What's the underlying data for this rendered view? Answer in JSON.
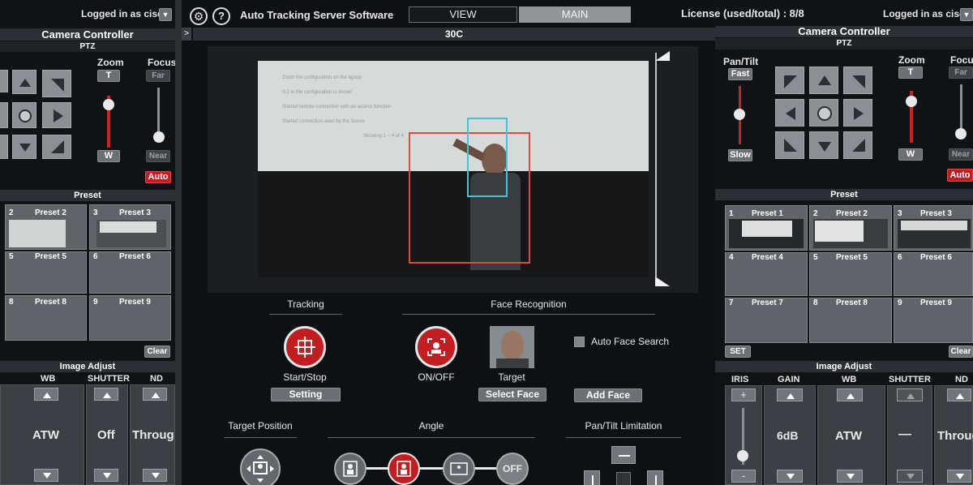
{
  "header": {
    "left_login": "Logged in as cisco",
    "title": "Auto Tracking Server Software",
    "tabs": [
      {
        "label": "VIEW"
      },
      {
        "label": "MAIN"
      }
    ],
    "license": "License (used/total) : 8/8",
    "right_login": "Logged in as cisco"
  },
  "left": {
    "title": "Camera Controller",
    "ptz": "PTZ",
    "zoom": "Zoom",
    "zoom_t": "T",
    "zoom_w": "W",
    "focus": "Focus",
    "focus_far": "Far",
    "focus_near": "Near",
    "focus_auto": "Auto",
    "preset_title": "Preset",
    "presets": [
      "2",
      "Preset 2",
      "3",
      "Preset 3",
      "5",
      "Preset 5",
      "6",
      "Preset 6",
      "8",
      "Preset 8",
      "9",
      "Preset 9"
    ],
    "clear": "Clear",
    "image_adjust": "Image Adjust",
    "wb": "WB",
    "shutter": "SHUTTER",
    "nd": "ND",
    "wb_val": "ATW",
    "shutter_val": "Off",
    "nd_val": "Throug"
  },
  "center": {
    "camera_name": "30C",
    "projected_text": [
      "Zoom the configuration on the laptop",
      "S.2 in the configuration is shown",
      "Started remote connection with an access function",
      "Started connection seen by the Server",
      "Showing 1 ~ 4 of 4"
    ],
    "tracking": "Tracking",
    "start_stop": "Start/Stop",
    "setting": "Setting",
    "face_recognition": "Face Recognition",
    "on_off": "ON/OFF",
    "target": "Target",
    "select_face": "Select Face",
    "auto_face_search": "Auto Face Search",
    "add_face": "Add Face",
    "target_position": "Target Position",
    "angle": "Angle",
    "angle_off": "OFF",
    "pan_tilt_limitation": "Pan/Tilt Limitation"
  },
  "right": {
    "title": "Camera Controller",
    "ptz": "PTZ",
    "pan_tilt": "Pan/Tilt",
    "fast": "Fast",
    "slow": "Slow",
    "zoom": "Zoom",
    "zoom_t": "T",
    "zoom_w": "W",
    "focus": "Focus",
    "focus_far": "Far",
    "focus_near": "Near",
    "focus_auto": "Auto",
    "preset_title": "Preset",
    "presets": [
      "1",
      "Preset 1",
      "2",
      "Preset 2",
      "3",
      "Preset 3",
      "4",
      "Preset 4",
      "5",
      "Preset 5",
      "6",
      "Preset 6",
      "7",
      "Preset 7",
      "8",
      "Preset 8",
      "9",
      "Preset 9"
    ],
    "set": "SET",
    "clear": "Clear",
    "image_adjust": "Image Adjust",
    "iris": "IRIS",
    "gain": "GAIN",
    "wb": "WB",
    "shutter": "SHUTTER",
    "nd": "ND",
    "iris_plus": "+",
    "iris_minus": "-",
    "gain_val": "6dB",
    "wb_val": "ATW",
    "shutter_val": "—",
    "nd_val": "Throug"
  },
  "colors": {
    "accent_red": "#c21e22",
    "tracking_box": "#e04a3c",
    "face_box": "#39c7e0",
    "tab_active": "#8f9599"
  }
}
